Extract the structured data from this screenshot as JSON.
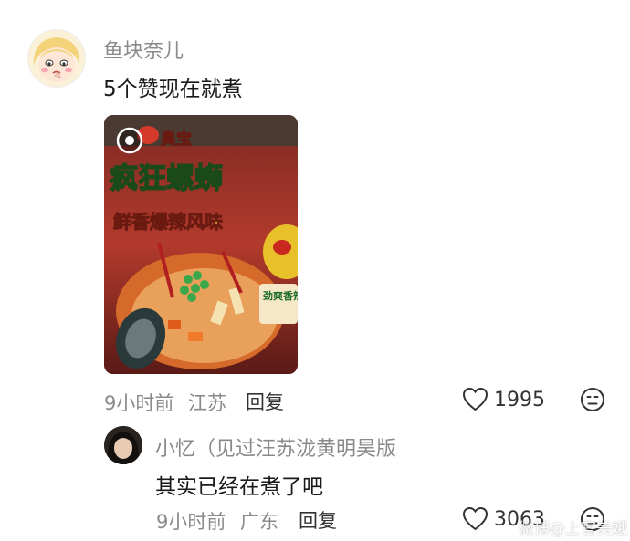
{
  "comment": {
    "username": "鱼块奈儿",
    "text": "5个赞现在就煮",
    "time": "9小时前",
    "location": "江苏",
    "reply_label": "回复",
    "likes": "1995"
  },
  "photo": {
    "brand_text": "臭宝",
    "product_name": "疯狂螺蛳",
    "flavor_text": "鲜香爆辣风味",
    "badge_text": "劲爽香辣"
  },
  "reply": {
    "username": "小忆（见过汪苏泷黄明昊版",
    "text": "其实已经在煮了吧",
    "time": "9小时前",
    "location": "广东",
    "reply_label": "回复",
    "likes": "3063"
  },
  "watermark": "微博@上官美娥",
  "colors": {
    "username_gray": "#8a8a8a",
    "text_black": "#1a1a1a",
    "package_red": "#8a2a24",
    "package_green": "#3aa84a"
  }
}
